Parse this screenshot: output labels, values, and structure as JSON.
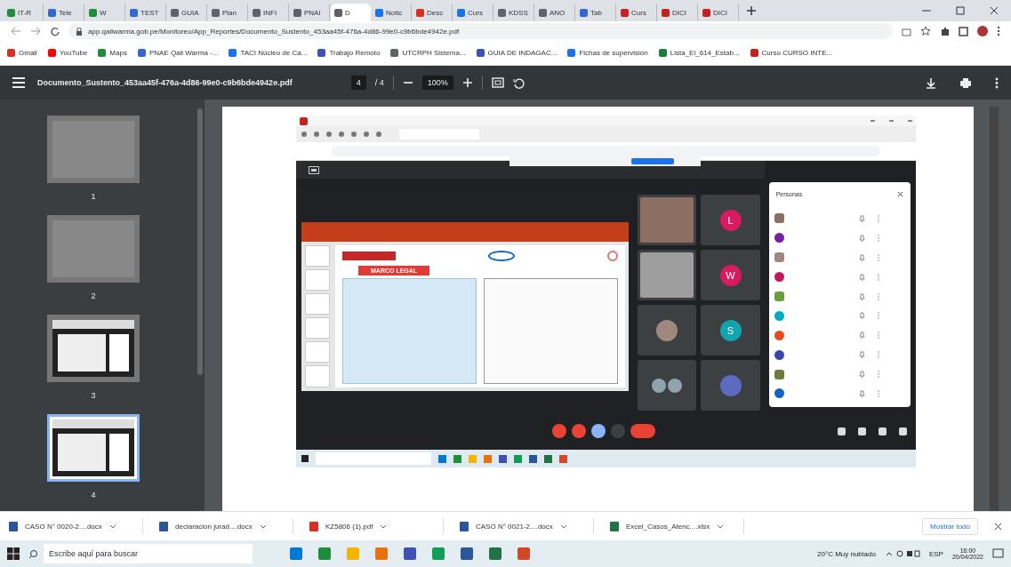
{
  "tabs": [
    {
      "label": "IT-R",
      "color": "#1e8e3e",
      "selected": false
    },
    {
      "label": "Tele",
      "color": "#3367d6",
      "selected": false
    },
    {
      "label": "W",
      "color": "#1e8e3e",
      "selected": false
    },
    {
      "label": "TEST",
      "color": "#3367d6",
      "selected": false
    },
    {
      "label": "GUIA",
      "color": "#5f6368",
      "selected": false
    },
    {
      "label": "Plan",
      "color": "#5f6368",
      "selected": false
    },
    {
      "label": "INFI",
      "color": "#5f6368",
      "selected": false
    },
    {
      "label": "PNAI",
      "color": "#5f6368",
      "selected": false
    },
    {
      "label": "D",
      "color": "#5f6368",
      "selected": true
    },
    {
      "label": "Notic",
      "color": "#1a73e8",
      "selected": false
    },
    {
      "label": "Desc",
      "color": "#d93025",
      "selected": false
    },
    {
      "label": "Curs",
      "color": "#1a73e8",
      "selected": false
    },
    {
      "label": "KDSS",
      "color": "#5f6368",
      "selected": false
    },
    {
      "label": "ANO",
      "color": "#5f6368",
      "selected": false
    },
    {
      "label": "Tab",
      "color": "#3367d6",
      "selected": false
    },
    {
      "label": "Curs",
      "color": "#c5221f",
      "selected": false
    },
    {
      "label": "DICI",
      "color": "#c5221f",
      "selected": false
    },
    {
      "label": "DICI",
      "color": "#c5221f",
      "selected": false
    }
  ],
  "address": "app.qaliwarma.gob.pe/Monitoreo/App_Reportes/Documento_Sustento_453aa45f-476a-4d86-99e0-c9b6bde4942e.pdf",
  "bookmarks": [
    {
      "label": "Gmail",
      "color": "#d93025"
    },
    {
      "label": "YouTube",
      "color": "#ff0000"
    },
    {
      "label": "Maps",
      "color": "#1e8e3e"
    },
    {
      "label": "PNAE Qali Warma -...",
      "color": "#3367d6"
    },
    {
      "label": "TACI Núcleo de Ca...",
      "color": "#1a73e8"
    },
    {
      "label": "Trabajo Remoto",
      "color": "#3f51b5"
    },
    {
      "label": "UTCRPH Sistema...",
      "color": "#5f6368"
    },
    {
      "label": "GUIA DE INDAGAC...",
      "color": "#3f51b5"
    },
    {
      "label": "Fichas de supervisión",
      "color": "#1a73e8"
    },
    {
      "label": "Lista_Ei_614_Estab...",
      "color": "#188038"
    },
    {
      "label": "Curso CURSO INTE...",
      "color": "#c5221f"
    }
  ],
  "pdf_toolbar": {
    "file_name": "Documento_Sustento_453aa45f-476a-4d86-99e0-c9b6bde4942e.pdf",
    "page": "4",
    "pages": "/ 4",
    "zoom": "100%"
  },
  "thumbnails": [
    {
      "label": "1",
      "kind": "blank",
      "selected": false
    },
    {
      "label": "2",
      "kind": "blank",
      "selected": false
    },
    {
      "label": "3",
      "kind": "screen",
      "selected": false
    },
    {
      "label": "4",
      "kind": "screen",
      "selected": true
    }
  ],
  "meet": {
    "slide_title": "MARCO LEGAL",
    "people_title": "Personas",
    "tiles": [
      {
        "kind": "video",
        "color": "#8d6e63"
      },
      {
        "kind": "initial",
        "initial": "L",
        "color": "#d81b60"
      },
      {
        "kind": "video",
        "color": "#9e9e9e"
      },
      {
        "kind": "initial",
        "initial": "W",
        "color": "#d81b60"
      },
      {
        "kind": "photo",
        "color": "#a1887f"
      },
      {
        "kind": "initial",
        "initial": "S",
        "color": "#12a4af"
      },
      {
        "kind": "pair",
        "color": "#90a4ae"
      },
      {
        "kind": "photo",
        "color": "#5c6bc0"
      }
    ],
    "people": [
      {
        "kind": "photo",
        "color": "#8d6e63"
      },
      {
        "kind": "initial",
        "color": "#7b1fa2"
      },
      {
        "kind": "photo",
        "color": "#a1887f"
      },
      {
        "kind": "initial",
        "color": "#c2185b"
      },
      {
        "kind": "photo",
        "color": "#689f38"
      },
      {
        "kind": "initial",
        "color": "#00acc1"
      },
      {
        "kind": "initial",
        "color": "#e64a19"
      },
      {
        "kind": "initial",
        "color": "#3949ab"
      },
      {
        "kind": "photo",
        "color": "#6d7c3a"
      },
      {
        "kind": "initial",
        "color": "#1565c0"
      }
    ]
  },
  "downloads": [
    {
      "label": "CASO N° 0020-2....docx",
      "kind": "word"
    },
    {
      "label": "declaracion jurad....docx",
      "kind": "word"
    },
    {
      "label": "KZ5806 (1).pdf",
      "kind": "pdf"
    },
    {
      "label": "CASO N° 0021-2....docx",
      "kind": "word"
    },
    {
      "label": "Excel_Casos_Atenc....xlsx",
      "kind": "excel"
    }
  ],
  "show_all": "Mostrar todo",
  "taskbar": {
    "search_placeholder": "Escribe aquí para buscar",
    "weather": "20°C Muy nublado",
    "language": "ESP",
    "time": "16:00",
    "date": "20/04/2022"
  }
}
